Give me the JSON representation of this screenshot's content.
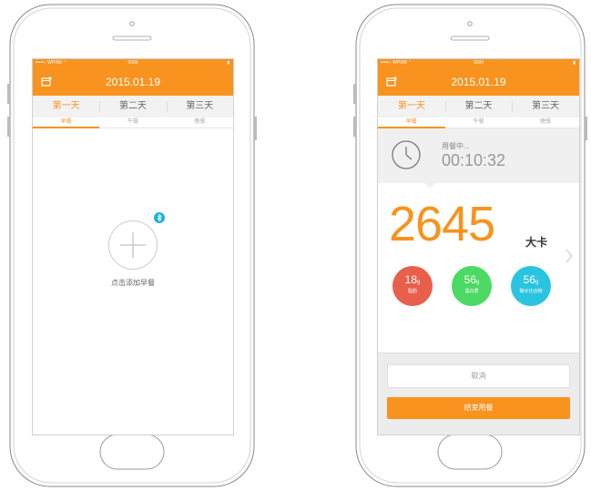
{
  "colors": {
    "accent": "#f7931e",
    "red": "#e8604c",
    "green": "#4cd964",
    "teal": "#2bc4e0",
    "bluetooth": "#1ab0e8"
  },
  "left_phone": {
    "status": {
      "carrier": "•••••○ WPIN6 ⌃",
      "time": "0000",
      "battery": "▮"
    },
    "header": {
      "date": "2015.01.19"
    },
    "day_tabs": [
      "第一天",
      "第二天",
      "第三天"
    ],
    "meal_tabs": [
      "早餐",
      "午餐",
      "晚餐"
    ],
    "add_meal_label": "点击添加早餐",
    "bluetooth_icon": "bluetooth-icon"
  },
  "right_phone": {
    "status": {
      "carrier": "•••••○ WPIN6 ⌃",
      "time": "0000",
      "battery": "▮"
    },
    "header": {
      "date": "2015.01.19"
    },
    "day_tabs": [
      "第一天",
      "第二天",
      "第三天"
    ],
    "meal_tabs": [
      "早餐",
      "午餐",
      "晚餐"
    ],
    "timer": {
      "status": "用餐中...",
      "time": "00:10:32"
    },
    "calories": {
      "value": "2645",
      "unit": "大卡"
    },
    "nutrients": [
      {
        "value": "18",
        "unit": "g",
        "label": "脂肪"
      },
      {
        "value": "56",
        "unit": "g",
        "label": "蛋白质"
      },
      {
        "value": "56",
        "unit": "g",
        "label": "碳水化合物"
      }
    ],
    "cancel_label": "取消",
    "finish_label": "结束用餐"
  }
}
